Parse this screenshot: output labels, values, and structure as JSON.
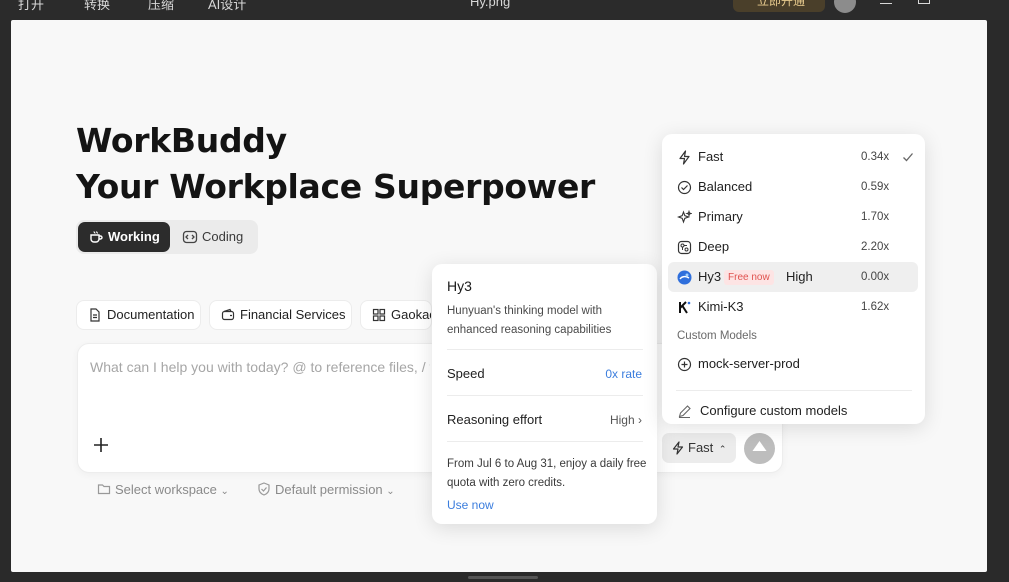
{
  "topbar": {
    "items": [
      "打开",
      "转换",
      "压缩",
      "AI设计"
    ],
    "title": "Hy.png",
    "badge": "立即开通"
  },
  "hero": {
    "line1": "WorkBuddy",
    "line2": "Your Workplace Superpower"
  },
  "modes": {
    "working": "Working",
    "coding": "Coding"
  },
  "chips": [
    "Documentation",
    "Financial Services",
    "Gaokao"
  ],
  "input": {
    "placeholder": "What can I help you with today? @ to reference files, / to",
    "model_label": "Fast"
  },
  "footer": {
    "workspace": "Select workspace",
    "permission": "Default permission"
  },
  "hy3_popover": {
    "title": "Hy3",
    "description": "Hunyuan's thinking model with enhanced reasoning capabilities",
    "speed_label": "Speed",
    "speed_value": "0x rate",
    "reasoning_label": "Reasoning effort",
    "reasoning_value": "High",
    "promo": "From Jul 6 to Aug 31, enjoy a daily free quota with zero credits.",
    "link": "Use now"
  },
  "model_menu": {
    "items": [
      {
        "name": "Fast",
        "rate": "0.34x",
        "icon": "bolt-icon",
        "checked": true
      },
      {
        "name": "Balanced",
        "rate": "0.59x",
        "icon": "check-circle-icon"
      },
      {
        "name": "Primary",
        "rate": "1.70x",
        "icon": "sparkle-icon"
      },
      {
        "name": "Deep",
        "rate": "2.20x",
        "icon": "brain-icon"
      },
      {
        "name": "Hy3",
        "rate": "0.00x",
        "icon": "hunyuan-logo-icon",
        "badge": "Free now",
        "extra": "High",
        "highlighted": true
      },
      {
        "name": "Kimi-K3",
        "rate": "1.62x",
        "icon": "kimi-logo-icon"
      }
    ],
    "custom_section": "Custom Models",
    "custom_item": "mock-server-prod",
    "configure": "Configure custom models"
  },
  "colors": {
    "accent_blue": "#3b7ddd",
    "badge_red": "#e0524f",
    "dark_button": "#2c2c2c"
  }
}
